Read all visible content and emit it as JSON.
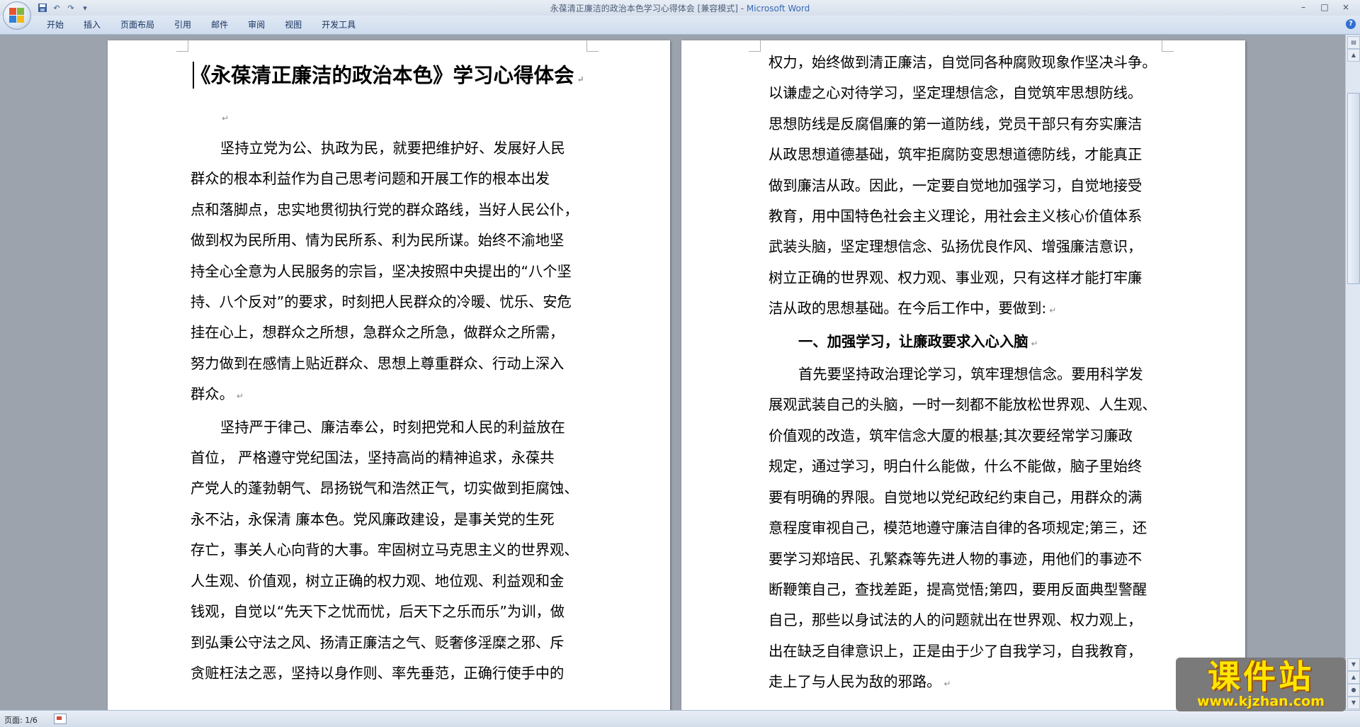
{
  "window": {
    "title_doc": "永葆清正廉洁的政治本色学习心得体会 [兼容模式] - ",
    "title_app": "Microsoft Word",
    "controls": {
      "minimize": "–",
      "maximize": "□",
      "close": "×"
    }
  },
  "quick_access": [
    "save-icon",
    "undo-icon",
    "redo-icon",
    "customize-icon"
  ],
  "ribbon": {
    "tabs": [
      "开始",
      "插入",
      "页面布局",
      "引用",
      "邮件",
      "审阅",
      "视图",
      "开发工具"
    ],
    "help": "?"
  },
  "document": {
    "heading": "《永葆清正廉洁的政治本色》学习心得体会",
    "paragraph_mark": "↵",
    "page1_lines": [
      {
        "text": "坚持立党为公、执政为民，就要把维护好、发展好人民",
        "indent": true,
        "pm": false
      },
      {
        "text": "群众的根本利益作为自己思考问题和开展工作的根本出发",
        "indent": false,
        "pm": false
      },
      {
        "text": "点和落脚点，忠实地贯彻执行党的群众路线，当好人民公仆，",
        "indent": false,
        "pm": false
      },
      {
        "text": "做到权为民所用、情为民所系、利为民所谋。始终不渝地坚",
        "indent": false,
        "pm": false
      },
      {
        "text": "持全心全意为人民服务的宗旨，坚决按照中央提出的“八个坚",
        "indent": false,
        "pm": false
      },
      {
        "text": "持、八个反对”的要求，时刻把人民群众的冷暖、忧乐、安危",
        "indent": false,
        "pm": false
      },
      {
        "text": "挂在心上，想群众之所想，急群众之所急，做群众之所需，",
        "indent": false,
        "pm": false
      },
      {
        "text": "努力做到在感情上贴近群众、思想上尊重群众、行动上深入",
        "indent": false,
        "pm": false
      },
      {
        "text": "群众。",
        "indent": false,
        "pm": true
      },
      {
        "text": "坚持严于律己、廉洁奉公，时刻把党和人民的利益放在",
        "indent": true,
        "pm": false
      },
      {
        "text": "首位， 严格遵守党纪国法，坚持高尚的精神追求，永葆共",
        "indent": false,
        "pm": false
      },
      {
        "text": "产党人的蓬勃朝气、昂扬锐气和浩然正气，切实做到拒腐蚀、",
        "indent": false,
        "pm": false
      },
      {
        "text": "永不沾，永保清 廉本色。党风廉政建设，是事关党的生死",
        "indent": false,
        "pm": false
      },
      {
        "text": "存亡，事关人心向背的大事。牢固树立马克思主义的世界观、",
        "indent": false,
        "pm": false
      },
      {
        "text": "人生观、价值观，树立正确的权力观、地位观、利益观和金",
        "indent": false,
        "pm": false
      },
      {
        "text": "钱观，自觉以“先天下之忧而忧，后天下之乐而乐”为训，做",
        "indent": false,
        "pm": false
      },
      {
        "text": "到弘秉公守法之风、扬清正廉洁之气、贬奢侈淫糜之邪、斥",
        "indent": false,
        "pm": false
      },
      {
        "text": "贪赃枉法之恶，坚持以身作则、率先垂范，正确行使手中的",
        "indent": false,
        "pm": false
      }
    ],
    "page2_lines": [
      {
        "text": "权力，始终做到清正廉洁，自觉同各种腐败现象作坚决斗争。",
        "indent": false,
        "pm": false,
        "bold": false
      },
      {
        "text": "以谦虚之心对待学习，坚定理想信念，自觉筑牢思想防线。",
        "indent": false,
        "pm": false,
        "bold": false
      },
      {
        "text": "思想防线是反腐倡廉的第一道防线，党员干部只有夯实廉洁",
        "indent": false,
        "pm": false,
        "bold": false
      },
      {
        "text": "从政思想道德基础，筑牢拒腐防变思想道德防线，才能真正",
        "indent": false,
        "pm": false,
        "bold": false
      },
      {
        "text": "做到廉洁从政。因此，一定要自觉地加强学习，自觉地接受",
        "indent": false,
        "pm": false,
        "bold": false
      },
      {
        "text": "教育，用中国特色社会主义理论，用社会主义核心价值体系",
        "indent": false,
        "pm": false,
        "bold": false
      },
      {
        "text": "武装头脑，坚定理想信念、弘扬优良作风、增强廉洁意识，",
        "indent": false,
        "pm": false,
        "bold": false
      },
      {
        "text": "树立正确的世界观、权力观、事业观，只有这样才能打牢廉",
        "indent": false,
        "pm": false,
        "bold": false
      },
      {
        "text": "洁从政的思想基础。在今后工作中，要做到:",
        "indent": false,
        "pm": true,
        "bold": false
      },
      {
        "text": "一、加强学习，让廉政要求入心入脑",
        "indent": true,
        "pm": true,
        "bold": true
      },
      {
        "text": "首先要坚持政治理论学习，筑牢理想信念。要用科学发",
        "indent": true,
        "pm": false,
        "bold": false
      },
      {
        "text": "展观武装自己的头脑，一时一刻都不能放松世界观、人生观、",
        "indent": false,
        "pm": false,
        "bold": false
      },
      {
        "text": "价值观的改造，筑牢信念大厦的根基;其次要经常学习廉政",
        "indent": false,
        "pm": false,
        "bold": false
      },
      {
        "text": "规定，通过学习，明白什么能做，什么不能做，脑子里始终",
        "indent": false,
        "pm": false,
        "bold": false
      },
      {
        "text": "要有明确的界限。自觉地以党纪政纪约束自己，用群众的满",
        "indent": false,
        "pm": false,
        "bold": false
      },
      {
        "text": "意程度审视自己，模范地遵守廉洁自律的各项规定;第三，还",
        "indent": false,
        "pm": false,
        "bold": false
      },
      {
        "text": "要学习郑培民、孔繁森等先进人物的事迹，用他们的事迹不",
        "indent": false,
        "pm": false,
        "bold": false
      },
      {
        "text": "断鞭策自己，查找差距，提高觉悟;第四，要用反面典型警醒",
        "indent": false,
        "pm": false,
        "bold": false
      },
      {
        "text": "自己，那些以身试法的人的问题就出在世界观、权力观上，",
        "indent": false,
        "pm": false,
        "bold": false
      },
      {
        "text": "出在缺乏自律意识上，正是由于少了自我学习，自我教育，",
        "indent": false,
        "pm": false,
        "bold": false
      },
      {
        "text": "走上了与人民为敌的邪路。",
        "indent": false,
        "pm": true,
        "bold": false
      }
    ]
  },
  "statusbar": {
    "page_info": "页面: 1/6"
  },
  "watermark": {
    "main": "课件站",
    "url": "www.kjzhan.com"
  },
  "colors": {
    "brand": "#3869b7",
    "watermark": "#ffe600"
  }
}
